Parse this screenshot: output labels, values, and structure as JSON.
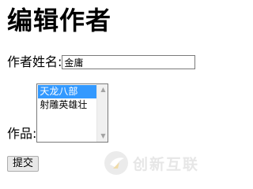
{
  "page": {
    "title": "编辑作者"
  },
  "form": {
    "name_label": "作者姓名:",
    "name_value": "金庸",
    "works_label": "作品:",
    "works_options": [
      {
        "label": "天龙八部",
        "selected": true
      },
      {
        "label": "射雕英雄壮",
        "selected": false
      }
    ],
    "submit_label": "提交"
  },
  "watermark": {
    "text": "创新互联"
  },
  "colors": {
    "selection": "#3399ff",
    "watermark": "#c9c9c9"
  }
}
